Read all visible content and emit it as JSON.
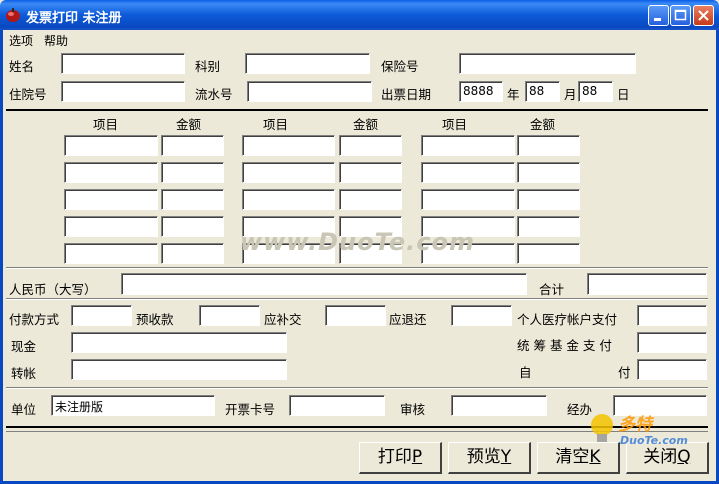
{
  "window": {
    "title": "发票打印 未注册"
  },
  "menu": {
    "items": [
      "选项",
      "帮助"
    ]
  },
  "patient": {
    "name_label": "姓名",
    "dept_label": "科别",
    "insurance_label": "保险号",
    "inpatient_label": "住院号",
    "serial_label": "流水号",
    "issue_date_label": "出票日期",
    "year_value": "8888",
    "year_label": "年",
    "month_value": "88",
    "month_label": "月",
    "day_value": "88",
    "day_label": "日"
  },
  "items_header": {
    "item": "项目",
    "amount": "金额"
  },
  "totals": {
    "rmb_label": "人民币（大写）",
    "total_label": "合计"
  },
  "payment": {
    "method_label": "付款方式",
    "prepaid_label": "预收款",
    "supplement_label": "应补交",
    "refund_label": "应退还",
    "personal_account_label": "个人医疗帐户支付",
    "cash_label": "现金",
    "transfer_label": "转帐",
    "pooled_fund_label": "统 筹 基 金 支 付",
    "self_pay_label_1": "自",
    "self_pay_label_2": "付"
  },
  "footer": {
    "unit_label": "单位",
    "unit_value": "未注册版",
    "card_label": "开票卡号",
    "review_label": "审核",
    "handler_label": "经办"
  },
  "buttons": {
    "print": {
      "text": "打印",
      "key": "P"
    },
    "preview": {
      "text": "预览",
      "key": "Y"
    },
    "clear": {
      "text": "清空",
      "key": "K"
    },
    "close": {
      "text": "关闭",
      "key": "Q"
    }
  },
  "watermark": {
    "site": "www.DuoTe.com",
    "logo_text": "多特",
    "logo_sub": "DuoTe.com"
  }
}
